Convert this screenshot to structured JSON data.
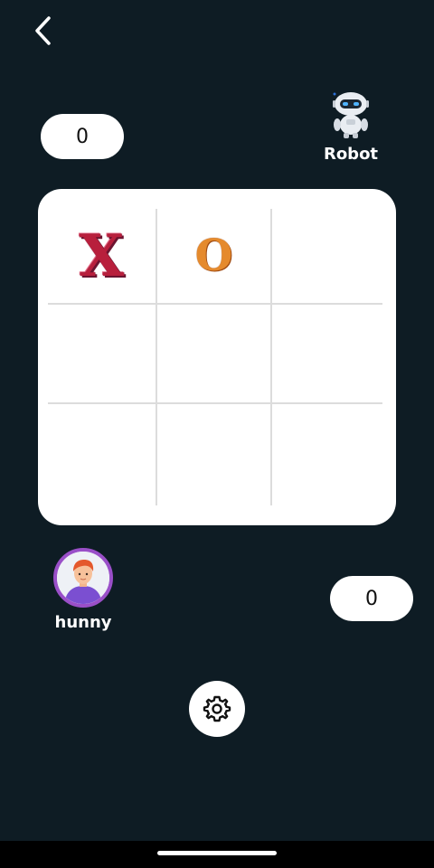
{
  "header": {
    "back_icon": "chevron-left-icon"
  },
  "scores": {
    "top": "0",
    "bottom": "0"
  },
  "players": {
    "robot": {
      "name": "Robot",
      "avatar_icon": "robot-icon"
    },
    "human": {
      "name": "hunny",
      "avatar_icon": "user-avatar-icon"
    }
  },
  "board": {
    "cells": [
      "X",
      "O",
      "",
      "",
      "",
      "",
      "",
      "",
      ""
    ]
  },
  "controls": {
    "settings_icon": "gear-icon"
  },
  "colors": {
    "background": "#0e1c24",
    "board": "#ffffff",
    "x_mark": "#b81f3c",
    "o_mark": "#e58a2d",
    "avatar_ring": "#9a4fc8"
  }
}
